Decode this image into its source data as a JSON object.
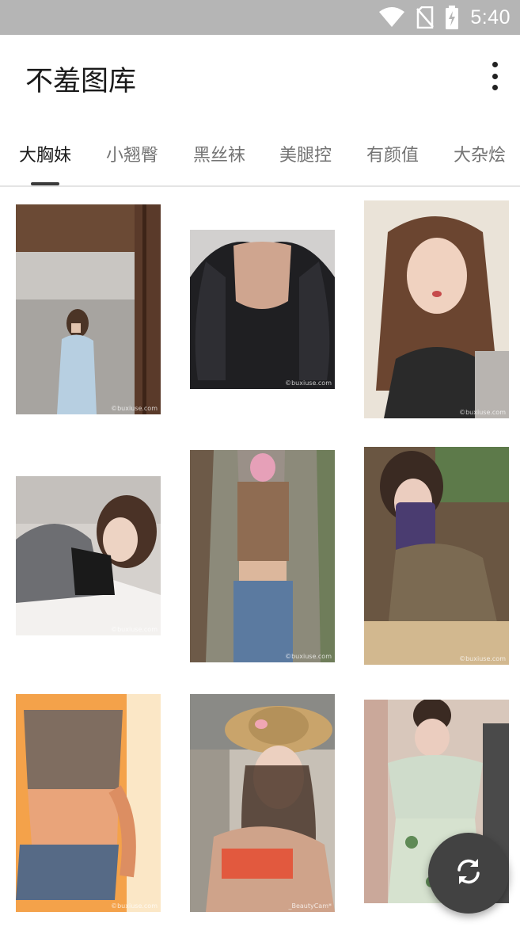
{
  "status_bar": {
    "time": "5:40",
    "icons": [
      "wifi-icon",
      "no-sim-icon",
      "battery-charging-icon"
    ]
  },
  "app_bar": {
    "title": "不羞图库",
    "menu_icon": "more-vert-icon"
  },
  "tabs": [
    {
      "label": "大胸妹",
      "active": true
    },
    {
      "label": "小翘臀",
      "active": false
    },
    {
      "label": "黑丝袜",
      "active": false
    },
    {
      "label": "美腿控",
      "active": false
    },
    {
      "label": "有颜值",
      "active": false
    },
    {
      "label": "大杂烩",
      "active": false
    }
  ],
  "photos": [
    {
      "watermark": "©buxiuse.com"
    },
    {
      "watermark": "©buxiuse.com"
    },
    {
      "watermark": "©buxiuse.com"
    },
    {
      "watermark": "©buxiuse.com"
    },
    {
      "watermark": "©buxiuse.com"
    },
    {
      "watermark": "©buxiuse.com"
    },
    {
      "watermark": "©buxiuse.com"
    },
    {
      "watermark": "_BeautyCam*"
    },
    {
      "watermark": ""
    }
  ],
  "fab": {
    "icon": "refresh-icon"
  },
  "colors": {
    "status_bar": "#b5b5b5",
    "fab": "#424242",
    "active_tab": "#1a1a1a",
    "inactive_tab": "#737373"
  }
}
